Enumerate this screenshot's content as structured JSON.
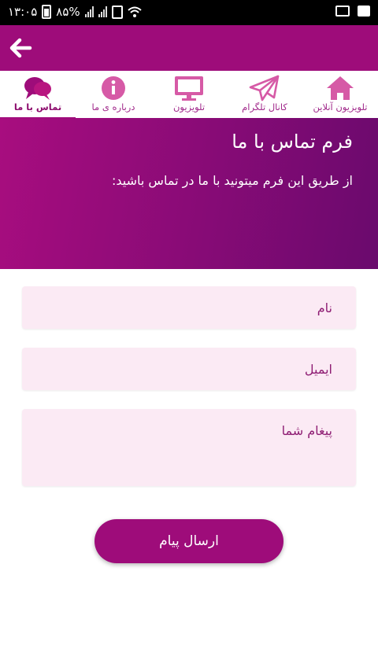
{
  "status_bar": {
    "time": "۱۳:۰۵",
    "battery": "۸۵%"
  },
  "app_bar": {
    "back_icon": "arrow-left-icon"
  },
  "tabs": [
    {
      "label": "تلویزیون آنلاین",
      "icon": "home-icon",
      "active": false
    },
    {
      "label": "کانال تلگرام",
      "icon": "paper-plane-icon",
      "active": false
    },
    {
      "label": "تلویزیون",
      "icon": "monitor-icon",
      "active": false
    },
    {
      "label": "درباره ی ما",
      "icon": "info-icon",
      "active": false
    },
    {
      "label": "تماس با ما",
      "icon": "chat-bubbles-icon",
      "active": true
    }
  ],
  "hero": {
    "title": "فرم تماس با ما",
    "subtitle": "از طریق این فرم میتونید با ما در تماس باشید:"
  },
  "form": {
    "name_placeholder": "نام",
    "email_placeholder": "ایمیل",
    "message_placeholder": "پیغام شما",
    "submit_label": "ارسال پیام"
  },
  "colors": {
    "primary": "#9e0c7a",
    "icon": "#d65aa6",
    "field_bg": "#fbeaf4",
    "hero_gradient_start": "#a80d7f",
    "hero_gradient_end": "#6a0a6d"
  }
}
